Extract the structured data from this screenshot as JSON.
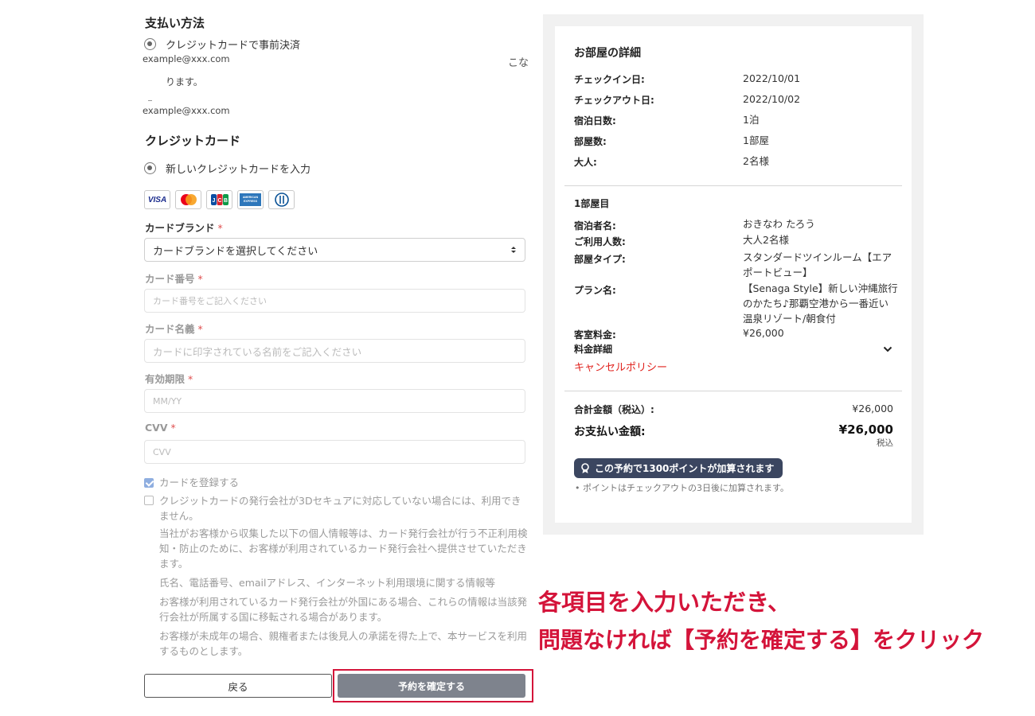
{
  "payment": {
    "heading": "支払い方法",
    "option_label": "クレジットカードで事前決済",
    "email_1": "example@xxx.com",
    "clipped_text": "こな",
    "note_text": "ります。",
    "email_2": "example@xxx.com"
  },
  "credit_card": {
    "heading": "クレジットカード",
    "new_card_label": "新しいクレジットカードを入力",
    "brand_logos": [
      "VISA",
      "Mastercard",
      "JCB",
      "AMERICAN EXPRESS",
      "Diners Club"
    ],
    "brand_label": "カードブランド",
    "brand_placeholder": "カードブランドを選択してください",
    "number_label": "カード番号",
    "number_placeholder": "カード番号をご記入ください",
    "name_label": "カード名義",
    "name_placeholder": "カードに印字されている名前をご記入ください",
    "expiry_label": "有効期限",
    "expiry_placeholder": "MM/YY",
    "cvv_label": "CVV",
    "cvv_placeholder": "CVV",
    "required_mark": "*",
    "save_card_label": "カードを登録する",
    "save_card_checked": true,
    "consent_label_1": "クレジットカードの発行会社が3Dセキュアに対応していない場合には、利用でき",
    "consent_label_2": "ません。",
    "consent_checked": false,
    "info_1a": "当社がお客様から収集した以下の個人情報等は、カード発行会社が行う不正利用検",
    "info_1b": "知・防止のために、お客様が利用されているカード発行会社へ提供させていただき",
    "info_1c": "ます。",
    "info_2": "氏名、電話番号、emailアドレス、インターネット利用環境に関する情報等",
    "info_3a": "お客様が利用されているカード発行会社が外国にある場合、これらの情報は当該発",
    "info_3b": "行会社が所属する国に移転される場合があります。",
    "info_4a": "お客様が未成年の場合、親権者または後見人の承諾を得た上で、本サービスを利用",
    "info_4b": "するものとします。"
  },
  "buttons": {
    "back": "戻る",
    "confirm": "予約を確定する"
  },
  "summary": {
    "title": "お部屋の詳細",
    "rows": [
      {
        "label": "チェックイン日:",
        "value": "2022/10/01"
      },
      {
        "label": "チェックアウト日:",
        "value": "2022/10/02"
      },
      {
        "label": "宿泊日数:",
        "value": "1泊"
      },
      {
        "label": "部屋数:",
        "value": "1部屋"
      },
      {
        "label": "大人:",
        "value": "2名様"
      }
    ],
    "room_heading": "1部屋目",
    "guest_label": "宿泊者名:",
    "guest_value": "おきなわ たろう",
    "people_label": "ご利用人数:",
    "people_value": "大人2名様",
    "room_type_label": "部屋タイプ:",
    "room_type_line1": "スタンダードツインルーム【エア",
    "room_type_line2": "ポートビュー】",
    "plan_label": "プラン名:",
    "plan_line1": "【Senaga Style】新しい沖縄旅行",
    "plan_line2": "のかたち♪那覇空港から一番近い",
    "plan_line3": "温泉リゾート/朝食付",
    "rate_label": "客室料金:",
    "rate_value": "¥26,000",
    "fee_detail_label": "料金詳細",
    "cancel_policy": "キャンセルポリシー",
    "total_label": "合計金額（税込）:",
    "total_value": "¥26,000",
    "payment_label": "お支払い金額:",
    "payment_value": "¥26,000",
    "tax_note": "税込",
    "points_badge": "この予約で1300ポイントが加算されます",
    "points_note": "ポイントはチェックアウトの3日後に加算されます。"
  },
  "annotation": {
    "line1": "各項目を入力いただき、",
    "line2": "問題なければ【予約を確定する】をクリック"
  },
  "colors": {
    "annotation_red": "#d4143a",
    "confirm_button": "#7e838d",
    "badge_bg": "#3b4660",
    "link_red": "#e0231e",
    "checkbox_blue": "#8faee0"
  }
}
